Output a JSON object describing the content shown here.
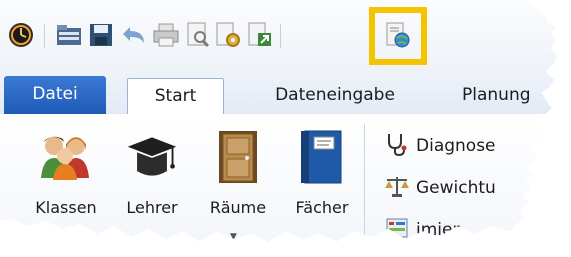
{
  "quick_access": {
    "icons": [
      "clock-icon",
      "folder-icon",
      "save-icon",
      "undo-icon",
      "print-icon",
      "print-preview-icon",
      "settings-doc-icon",
      "export-icon",
      "web-document-icon"
    ]
  },
  "tabs": {
    "file": "Datei",
    "start": "Start",
    "data_entry": "Dateneingabe",
    "planning": "Planung"
  },
  "ribbon": {
    "classes": "Klassen",
    "teachers": "Lehrer",
    "rooms": "Räume",
    "subjects": "Fächer",
    "diagnosis": "Diagnose",
    "weighting": "Gewichtu",
    "optimize": "imier"
  },
  "colors": {
    "accent": "#1e5bb7",
    "highlight": "#f5c400"
  }
}
